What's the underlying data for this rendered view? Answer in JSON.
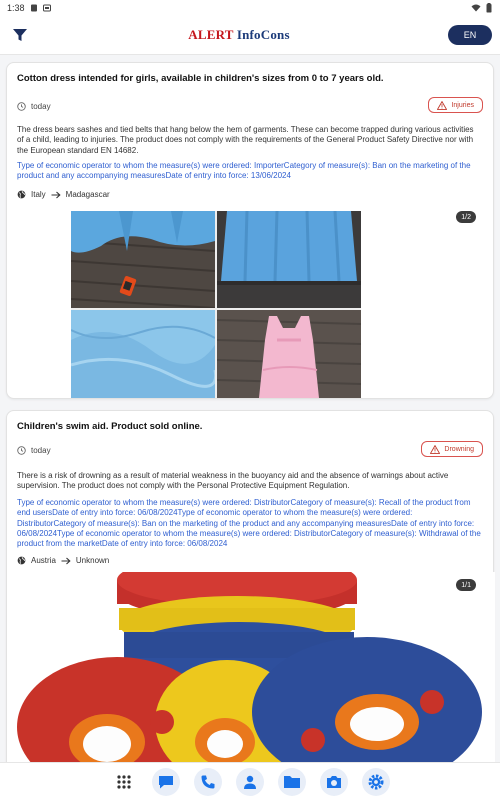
{
  "status": {
    "time": "1:38",
    "network": "EN"
  },
  "appbar": {
    "title_part1": "ALERT",
    "title_part2": "InfoCons",
    "language": "EN"
  },
  "alerts": [
    {
      "title": "Cotton dress intended for girls, available in children's sizes from 0 to 7 years old.",
      "time": "today",
      "risk": "Injuries",
      "description": "The dress bears sashes and tied belts that hang below the hem of garments. These can become trapped during various activities of a child, leading to injuries. The product does not comply with the requirements of the General Product Safety Directive nor with the European standard EN 14682.",
      "measures": "Type of economic operator to whom the measure(s) were ordered: ImporterCategory of measure(s): Ban on the marketing of the product and any accompanying measuresDate of entry into force: 13/06/2024",
      "origin": "Italy",
      "destination": "Madagascar",
      "image_counter": "1/2"
    },
    {
      "title": "Children's swim aid. Product sold online.",
      "time": "today",
      "risk": "Drowning",
      "description": "There is a risk of drowning as a result of material weakness in the buoyancy aid and the absence of warnings about active supervision. The product does not comply with the Personal Protective Equipment Regulation.",
      "measures": "Type of economic operator to whom the measure(s) were ordered: DistributorCategory of measure(s): Recall of the product from end usersDate of entry into force: 06/08/2024Type of economic operator to whom the measure(s) were ordered: DistributorCategory of measure(s): Ban on the marketing of the product and any accompanying measuresDate of entry into force: 06/08/2024Type of economic operator to whom the measure(s) were ordered: DistributorCategory of measure(s): Withdrawal of the product from the marketDate of entry into force: 06/08/2024",
      "origin": "Austria",
      "destination": "Unknown",
      "image_counter": "1/1"
    }
  ],
  "colors": {
    "accent": "#1c2f5f",
    "link": "#2f5fd0",
    "risk": "#c0392b",
    "brand_red": "#c4161c",
    "brand_blue": "#1c3b7a"
  },
  "nav": {
    "items": [
      "apps-icon",
      "chat-icon",
      "phone-icon",
      "contacts-icon",
      "files-icon",
      "camera-icon",
      "settings-icon"
    ]
  }
}
